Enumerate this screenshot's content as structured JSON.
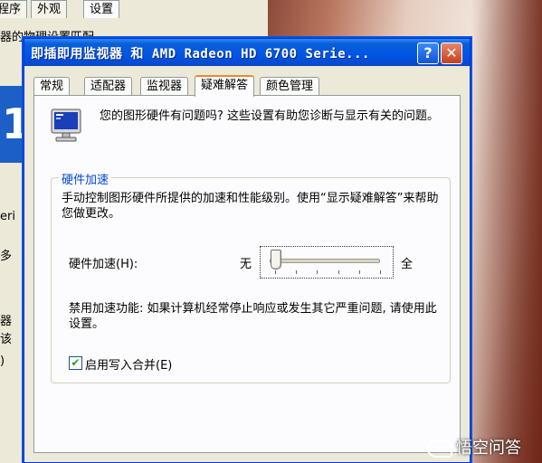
{
  "background_window": {
    "tabs": [
      "程序",
      "外观",
      "设置"
    ],
    "line1": "器的物理设置匹配",
    "big_digit": "1",
    "fragments": [
      "eri",
      "多",
      "器",
      "该",
      ")"
    ]
  },
  "dialog": {
    "title": "即插即用监视器 和 AMD Radeon HD 6700 Serie...",
    "help_label": "?",
    "close_label": "✕",
    "tabs": [
      {
        "label": "常规"
      },
      {
        "label": "适配器"
      },
      {
        "label": "监视器"
      },
      {
        "label": "疑难解答"
      },
      {
        "label": "颜色管理"
      }
    ],
    "active_tab": "疑难解答",
    "monitor_icon": "monitor-icon",
    "intro_text": "您的图形硬件有问题吗? 这些设置有助您诊断与显示有关的问题。",
    "group": {
      "title": "硬件加速",
      "description": "手动控制图形硬件所提供的加速和性能级别。使用“显示疑难解答”来帮助您做更改。",
      "accel_label": "硬件加速(H):",
      "slider_min_label": "无",
      "slider_max_label": "全",
      "slider_position": 0,
      "slider_steps": 6,
      "warning_text": "禁用加速功能: 如果计算机经常停止响应或发生其它严重问题, 请使用此设置。",
      "write_combining_label": "启用写入合并(E)",
      "write_combining_checked": true
    }
  },
  "watermark": {
    "text": "悟空问答"
  }
}
